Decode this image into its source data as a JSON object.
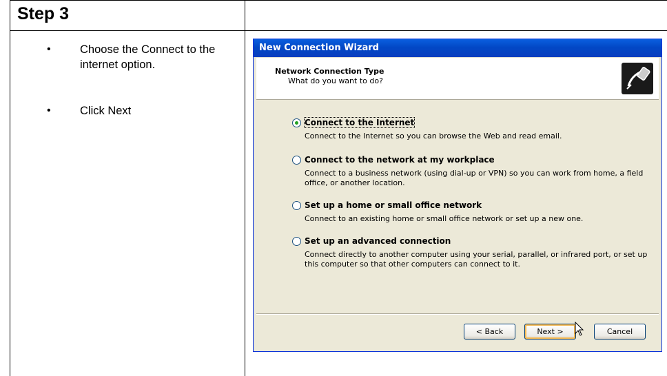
{
  "step": {
    "title": "Step 3"
  },
  "instructions": [
    {
      "bullet": "•",
      "text": "Choose the Connect to the internet option."
    },
    {
      "bullet": "•",
      "text": "Click Next"
    }
  ],
  "wizard": {
    "title": "New Connection Wizard",
    "header_title": "Network Connection Type",
    "header_subtitle": "What do you want to do?",
    "options": [
      {
        "label": "Connect to the Internet",
        "description": "Connect to the Internet so you can browse the Web and read email.",
        "selected": true
      },
      {
        "label": "Connect to the network at my workplace",
        "description": "Connect to a business network (using dial-up or VPN) so you can work from home, a field office, or another location.",
        "selected": false
      },
      {
        "label": "Set up a home or small office network",
        "description": "Connect to an existing home or small office network or set up a new one.",
        "selected": false
      },
      {
        "label": "Set up an advanced connection",
        "description": "Connect directly to another computer using your serial, parallel, or infrared port, or set up this computer so that other computers can connect to it.",
        "selected": false
      }
    ],
    "buttons": {
      "back": "< Back",
      "next": "Next >",
      "cancel": "Cancel"
    }
  }
}
